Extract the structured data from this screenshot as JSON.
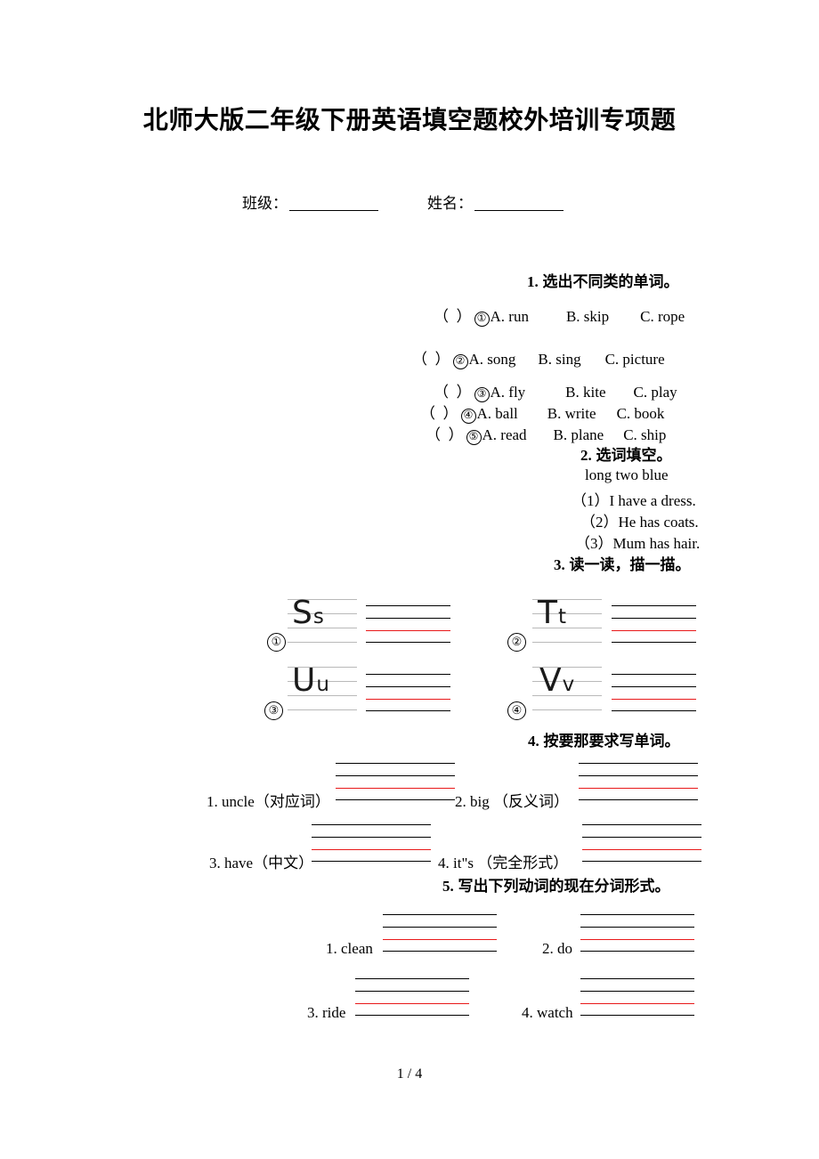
{
  "document": {
    "title": "北师大版二年级下册英语填空题校外培训专项题",
    "footer": "1 / 4"
  },
  "student_info": {
    "class_label": "班级：",
    "name_label": "姓名："
  },
  "section1": {
    "heading_number": "1.",
    "heading_text": "选出不同类的单词。",
    "questions": [
      {
        "index": "①",
        "paren_open": "（",
        "paren_close": "）",
        "a": "A. run",
        "b": "B. skip",
        "c": "C. rope"
      },
      {
        "index": "②",
        "paren_open": "（",
        "paren_close": "）",
        "a": "A. song",
        "b": "B. sing",
        "c": "C. picture"
      },
      {
        "index": "③",
        "paren_open": "（",
        "paren_close": "）",
        "a": "A. fly",
        "b": "B. kite",
        "c": "C. play"
      },
      {
        "index": "④",
        "paren_open": "（",
        "paren_close": "）",
        "a": "A. ball",
        "b": "B. write",
        "c": "C. book"
      },
      {
        "index": "⑤",
        "paren_open": "（",
        "paren_close": "）",
        "a": "A. read",
        "b": "B. plane",
        "c": "C. ship"
      }
    ]
  },
  "section2": {
    "heading_number": "2.",
    "heading_text": "选词填空。",
    "word_bank": "long   two   blue",
    "sentences": [
      "（1）I have a    dress.",
      "（2）He has    coats.",
      "（3）Mum has    hair."
    ]
  },
  "section3": {
    "heading_number": "3.",
    "heading_text": "读一读，描一描。",
    "items": [
      {
        "index": "①",
        "capital": "S",
        "lowercase": "s"
      },
      {
        "index": "②",
        "capital": "T",
        "lowercase": "t"
      },
      {
        "index": "③",
        "capital": "U",
        "lowercase": "u"
      },
      {
        "index": "④",
        "capital": "V",
        "lowercase": "v"
      }
    ]
  },
  "section4": {
    "heading_number": "4.",
    "heading_text": "按要那要求写单词。",
    "items": [
      {
        "label": "1. uncle（对应词）"
      },
      {
        "label": "2. big （反义词）"
      },
      {
        "label": "3. have（中文）"
      },
      {
        "label": "4. it\"s （完全形式）"
      }
    ]
  },
  "section5": {
    "heading_number": "5.",
    "heading_text": "写出下列动词的现在分词形式。",
    "items": [
      {
        "label": "1. clean"
      },
      {
        "label": "2. do"
      },
      {
        "label": "3. ride"
      },
      {
        "label": "4. watch"
      }
    ]
  },
  "colors": {
    "stave_red": "#e8191a",
    "stave_black": "#000000",
    "stave_gray": "#b9b9b9"
  }
}
